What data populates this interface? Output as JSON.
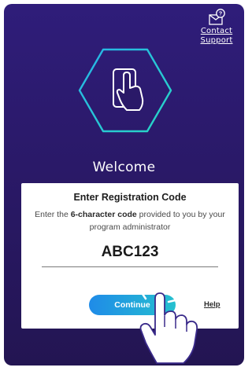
{
  "support": {
    "line1": "Contact",
    "line2": "Support",
    "icon": "envelope-question-icon"
  },
  "hero": {
    "icon": "hexagon-phone-tap-icon"
  },
  "welcome": "Welcome",
  "card": {
    "title": "Enter Registration Code",
    "desc_pre": "Enter the ",
    "desc_bold": "6-character code",
    "desc_post": " provided to you by your program administrator",
    "code_value": "ABC123",
    "continue_label": "Continue",
    "help_label": "Help"
  },
  "overlay": {
    "icon": "tap-hand-icon"
  },
  "colors": {
    "background": "#2a1968",
    "accent_blue": "#1f8be8",
    "accent_teal": "#25c0cf"
  }
}
